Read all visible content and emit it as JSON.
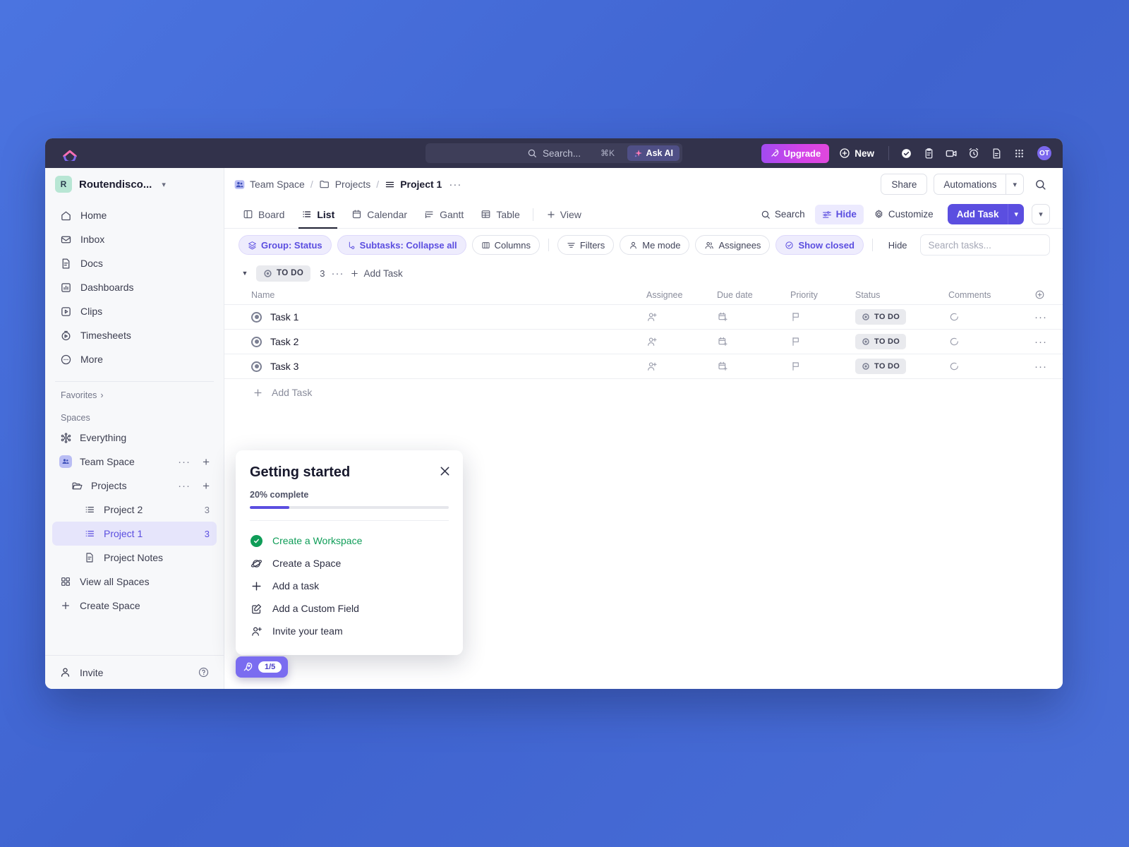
{
  "topbar": {
    "logo": "clickup-logo",
    "search_placeholder": "Search...",
    "search_shortcut": "⌘K",
    "ask_ai_label": "Ask AI",
    "upgrade_label": "Upgrade",
    "new_label": "New",
    "avatar_initials": "OT",
    "icons": [
      "check-circle-icon",
      "clipboard-icon",
      "video-camera-icon",
      "alarm-clock-icon",
      "document-icon",
      "apps-grid-icon"
    ]
  },
  "sidebar": {
    "workspace": {
      "badge": "R",
      "name": "Routendisco...",
      "caret": "chevron-down-icon"
    },
    "nav_items": [
      {
        "label": "Home",
        "icon": "home-icon"
      },
      {
        "label": "Inbox",
        "icon": "inbox-icon"
      },
      {
        "label": "Docs",
        "icon": "docs-icon"
      },
      {
        "label": "Dashboards",
        "icon": "dashboards-icon"
      },
      {
        "label": "Clips",
        "icon": "clips-icon"
      },
      {
        "label": "Timesheets",
        "icon": "timesheets-icon"
      },
      {
        "label": "More",
        "icon": "more-icon"
      }
    ],
    "favorites_label": "Favorites",
    "spaces_label": "Spaces",
    "spaces": [
      {
        "label": "Everything",
        "icon": "everything-icon",
        "indent": 0,
        "count": "",
        "dots": false,
        "plus": false,
        "active": false
      },
      {
        "label": "Team Space",
        "icon": "team-space-icon",
        "indent": 0,
        "count": "",
        "dots": true,
        "plus": true,
        "active": false
      },
      {
        "label": "Projects",
        "icon": "folder-icon",
        "indent": 1,
        "count": "",
        "dots": true,
        "plus": true,
        "active": false
      },
      {
        "label": "Project 2",
        "icon": "list-icon",
        "indent": 2,
        "count": "3",
        "dots": false,
        "plus": false,
        "active": false
      },
      {
        "label": "Project 1",
        "icon": "list-icon",
        "indent": 2,
        "count": "3",
        "dots": false,
        "plus": false,
        "active": true
      },
      {
        "label": "Project Notes",
        "icon": "doc-icon",
        "indent": 2,
        "count": "",
        "dots": false,
        "plus": false,
        "active": false
      }
    ],
    "view_all_spaces": "View all Spaces",
    "create_space": "Create Space",
    "invite_label": "Invite",
    "help_icon": "question-mark-icon"
  },
  "breadcrumb": {
    "items": [
      {
        "label": "Team Space",
        "icon": "team-space-icon"
      },
      {
        "label": "Projects",
        "icon": "folder-icon"
      },
      {
        "label": "Project 1",
        "icon": "list-icon"
      }
    ],
    "separator": "/",
    "overflow": "···",
    "share_label": "Share",
    "automations_label": "Automations",
    "search_icon": "search-icon"
  },
  "tabs": {
    "items": [
      {
        "label": "Board",
        "icon": "board-icon",
        "active": false
      },
      {
        "label": "List",
        "icon": "list-icon",
        "active": true
      },
      {
        "label": "Calendar",
        "icon": "calendar-icon",
        "active": false
      },
      {
        "label": "Gantt",
        "icon": "gantt-icon",
        "active": false
      },
      {
        "label": "Table",
        "icon": "table-icon",
        "active": false
      }
    ],
    "add_view_label": "View",
    "search_label": "Search",
    "hide_label": "Hide",
    "customize_label": "Customize",
    "add_task_label": "Add Task"
  },
  "filters": {
    "chips": [
      {
        "label": "Group: Status",
        "icon": "layers-icon",
        "highlight": true
      },
      {
        "label": "Subtasks: Collapse all",
        "icon": "subtask-icon",
        "highlight": true
      },
      {
        "label": "Columns",
        "icon": "columns-icon",
        "highlight": false
      },
      {
        "label": "Filters",
        "icon": "filter-icon",
        "highlight": false
      },
      {
        "label": "Me mode",
        "icon": "person-icon",
        "highlight": false
      },
      {
        "label": "Assignees",
        "icon": "people-icon",
        "highlight": false
      },
      {
        "label": "Show closed",
        "icon": "check-circle-icon",
        "highlight": true
      }
    ],
    "hide_label": "Hide",
    "search_placeholder": "Search tasks..."
  },
  "task_group": {
    "status_label": "TO DO",
    "count": "3",
    "dots": "···",
    "add_task_label": "Add Task",
    "columns": [
      "Name",
      "Assignee",
      "Due date",
      "Priority",
      "Status",
      "Comments"
    ],
    "add_column_icon": "plus-circle-icon",
    "rows": [
      {
        "name": "Task 1",
        "assignee": "",
        "due_date": "",
        "priority": "",
        "status": "TO DO",
        "comments": ""
      },
      {
        "name": "Task 2",
        "assignee": "",
        "due_date": "",
        "priority": "",
        "status": "TO DO",
        "comments": ""
      },
      {
        "name": "Task 3",
        "assignee": "",
        "due_date": "",
        "priority": "",
        "status": "TO DO",
        "comments": ""
      }
    ],
    "add_task_bottom_label": "Add Task"
  },
  "getting_started": {
    "title": "Getting started",
    "progress_label": "20% complete",
    "progress_percent": 20,
    "close_icon": "close-icon",
    "steps": [
      {
        "label": "Create a Workspace",
        "icon": "check-filled-icon",
        "done": true
      },
      {
        "label": "Create a Space",
        "icon": "planet-icon",
        "done": false
      },
      {
        "label": "Add a task",
        "icon": "plus-icon",
        "done": false
      },
      {
        "label": "Add a Custom Field",
        "icon": "edit-square-icon",
        "done": false
      },
      {
        "label": "Invite your team",
        "icon": "person-add-icon",
        "done": false
      }
    ],
    "badge": {
      "icon": "rocket-icon",
      "count": "1/5"
    }
  },
  "colors": {
    "brand_purple": "#5b4ee0",
    "topbar_bg": "#32324b",
    "desktop_bg": "#4169d8",
    "accent_green": "#0f9d58",
    "upgrade_gradient_start": "#a24bf0",
    "upgrade_gradient_end": "#e048dd"
  }
}
